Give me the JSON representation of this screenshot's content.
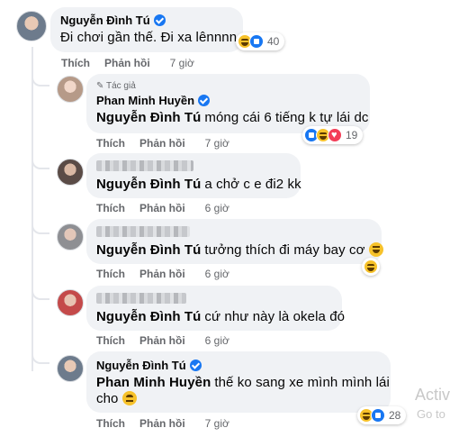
{
  "comments": [
    {
      "name": "Nguyễn Đình Tú",
      "text": "Đi chơi gần thế. Đi xa lênnnn",
      "reactions": "40",
      "time": "7 giờ"
    },
    {
      "author_badge": "Tác giả",
      "name": "Phan Minh Huyền",
      "tag": "Nguyễn Đình Tú",
      "text": "móng cái 6 tiếng k tự lái dc",
      "reactions": "19",
      "time": "7 giờ"
    },
    {
      "tag": "Nguyễn Đình Tú",
      "text": "a chở c e đi2 kk",
      "time": "6 giờ"
    },
    {
      "tag": "Nguyễn Đình Tú",
      "text": "tưởng thích đi máy bay cơ",
      "time": "6 giờ"
    },
    {
      "tag": "Nguyễn Đình Tú",
      "text": "cứ như này là okela đó",
      "time": "6 giờ"
    },
    {
      "name": "Nguyễn Đình Tú",
      "tag": "Phan Minh Huyền",
      "text": "thế ko sang xe mình mình lái",
      "text2": "cho",
      "reactions": "28",
      "time": "7 giờ"
    }
  ],
  "actions": {
    "like": "Thích",
    "reply": "Phản hồi"
  },
  "watermark": {
    "line1": "Activ",
    "line2": "Go to"
  },
  "colors": {
    "bubble": "#f0f2f5",
    "verified": "#1877f2",
    "meta": "#65676b"
  }
}
